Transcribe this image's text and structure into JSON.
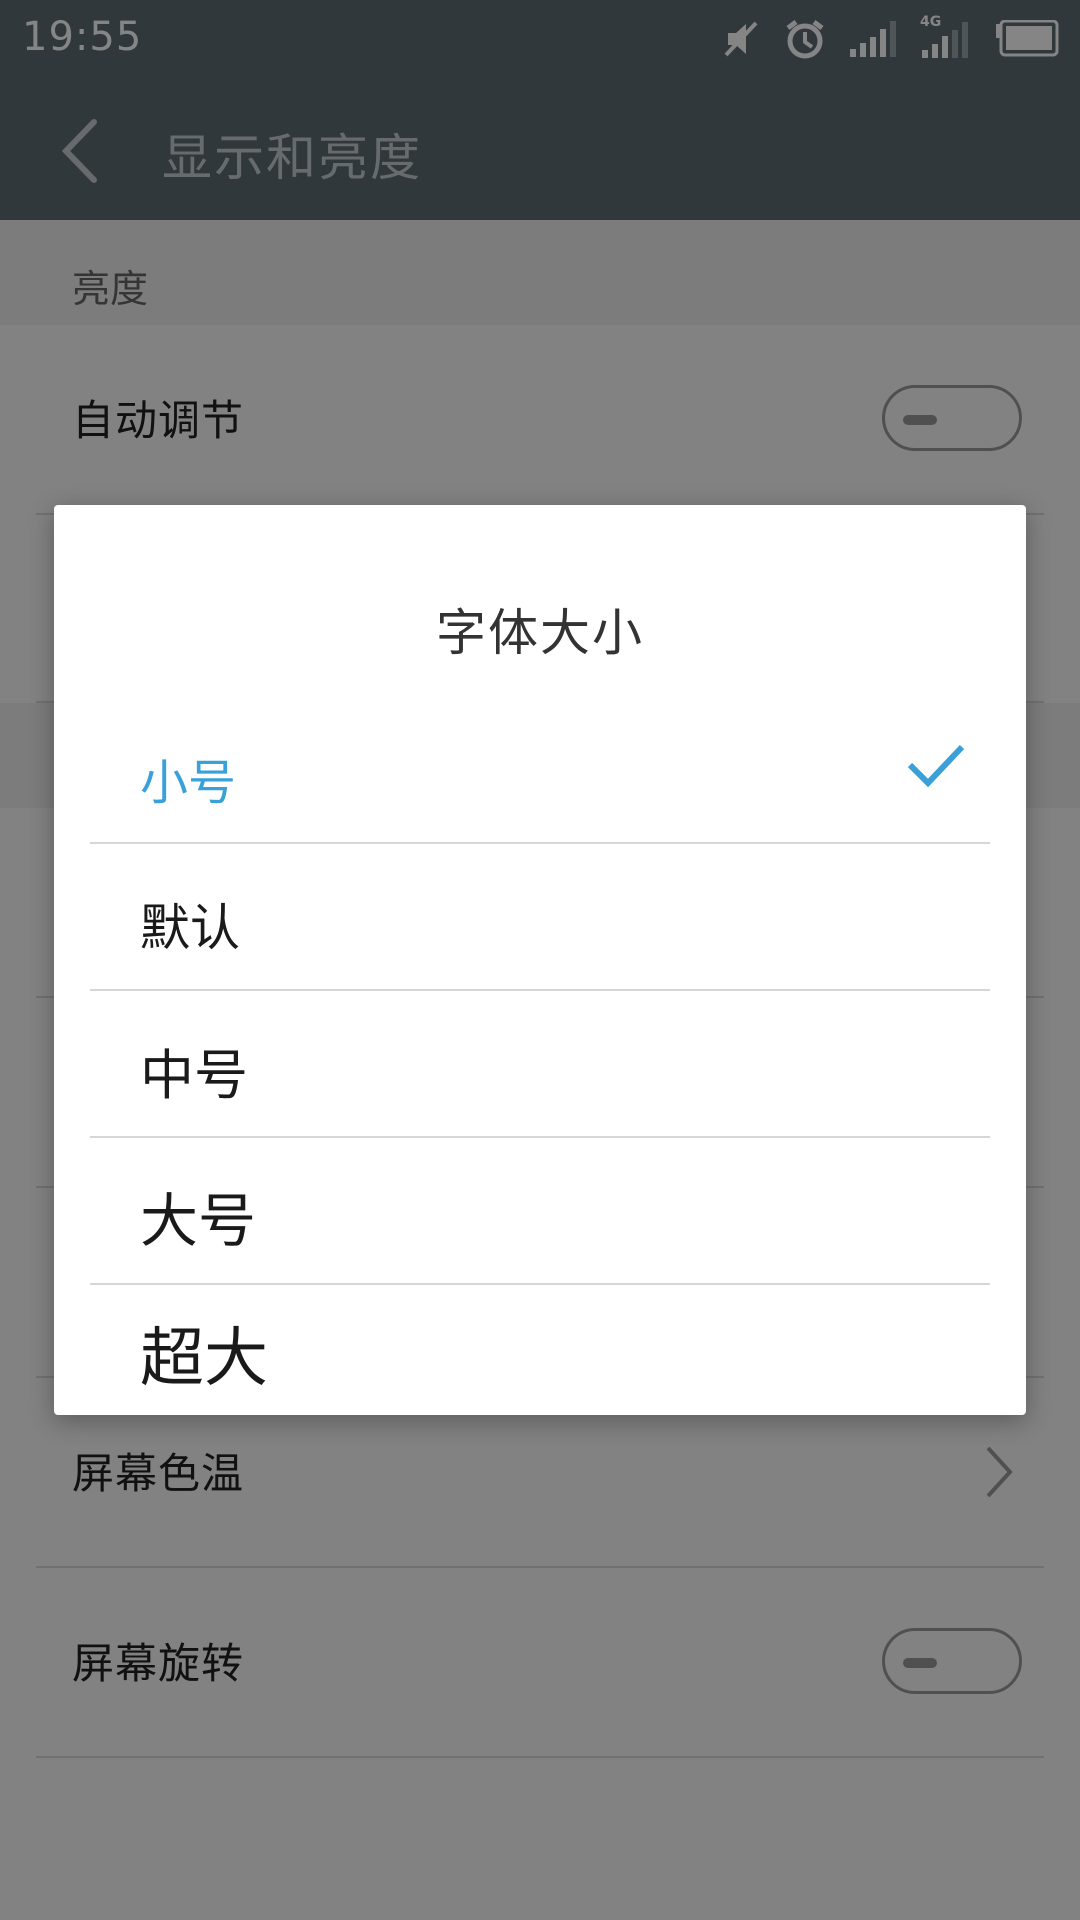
{
  "status_bar": {
    "time": "19:55",
    "network_label": "4G",
    "icons": [
      "mute-icon",
      "alarm-icon",
      "signal-icon",
      "signal-4g-icon",
      "battery-icon"
    ]
  },
  "app_bar": {
    "title": "显示和亮度",
    "back_icon": "chevron-left-icon"
  },
  "settings": {
    "brightness_header": "亮度",
    "auto_adjust": {
      "label": "自动调节",
      "enabled": false
    },
    "color_temperature": {
      "label": "屏幕色温"
    },
    "screen_rotation": {
      "label": "屏幕旋转",
      "enabled": false
    }
  },
  "dialog": {
    "title": "字体大小",
    "selected_index": 0,
    "options": [
      {
        "label": "小号"
      },
      {
        "label": "默认"
      },
      {
        "label": "中号"
      },
      {
        "label": "大号"
      },
      {
        "label": "超大"
      }
    ]
  },
  "colors": {
    "accent": "#3aa1d8",
    "app_bar": "#5f6b72",
    "text_primary": "#1a1a1a"
  }
}
